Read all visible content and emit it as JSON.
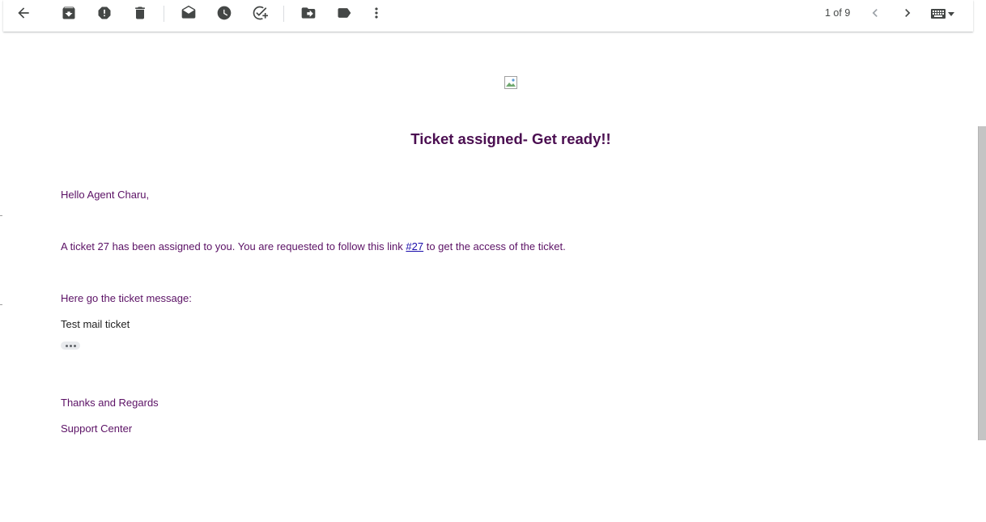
{
  "toolbar": {
    "buttons": [
      {
        "name": "back-button",
        "icon": "arrow-back-icon",
        "label": "Back to Inbox"
      },
      {
        "name": "archive-button",
        "icon": "archive-icon",
        "label": "Archive"
      },
      {
        "name": "report-spam-button",
        "icon": "report-spam-icon",
        "label": "Report spam"
      },
      {
        "name": "delete-button",
        "icon": "trash-icon",
        "label": "Delete"
      },
      {
        "name": "mark-unread-button",
        "icon": "mail-icon",
        "label": "Mark as unread"
      },
      {
        "name": "snooze-button",
        "icon": "clock-icon",
        "label": "Snooze"
      },
      {
        "name": "add-to-tasks-button",
        "icon": "add-task-icon",
        "label": "Add to Tasks"
      },
      {
        "name": "move-to-button",
        "icon": "move-to-icon",
        "label": "Move to"
      },
      {
        "name": "labels-button",
        "icon": "label-icon",
        "label": "Labels"
      },
      {
        "name": "more-button",
        "icon": "more-vert-icon",
        "label": "More"
      }
    ],
    "pager": "1 of 9",
    "newer_icon": "chevron-left-icon",
    "older_icon": "chevron-right-icon",
    "input_tools_icon": "keyboard-icon"
  },
  "email": {
    "heading": "Ticket assigned- Get ready!!",
    "greeting": "Hello Agent Charu,",
    "body_before_link": "A ticket 27 has been assigned to you. You are requested to follow this link ",
    "link_text": "#27",
    "body_after_link": " to get the access of the ticket.",
    "message_intro": "Here go the ticket message:",
    "ticket_message": "Test mail ticket",
    "closing": "Thanks and Regards",
    "signature": "Support Center"
  },
  "colors": {
    "heading": "#4b0f51",
    "body_text": "#5b1165",
    "link": "#1a0dab"
  }
}
